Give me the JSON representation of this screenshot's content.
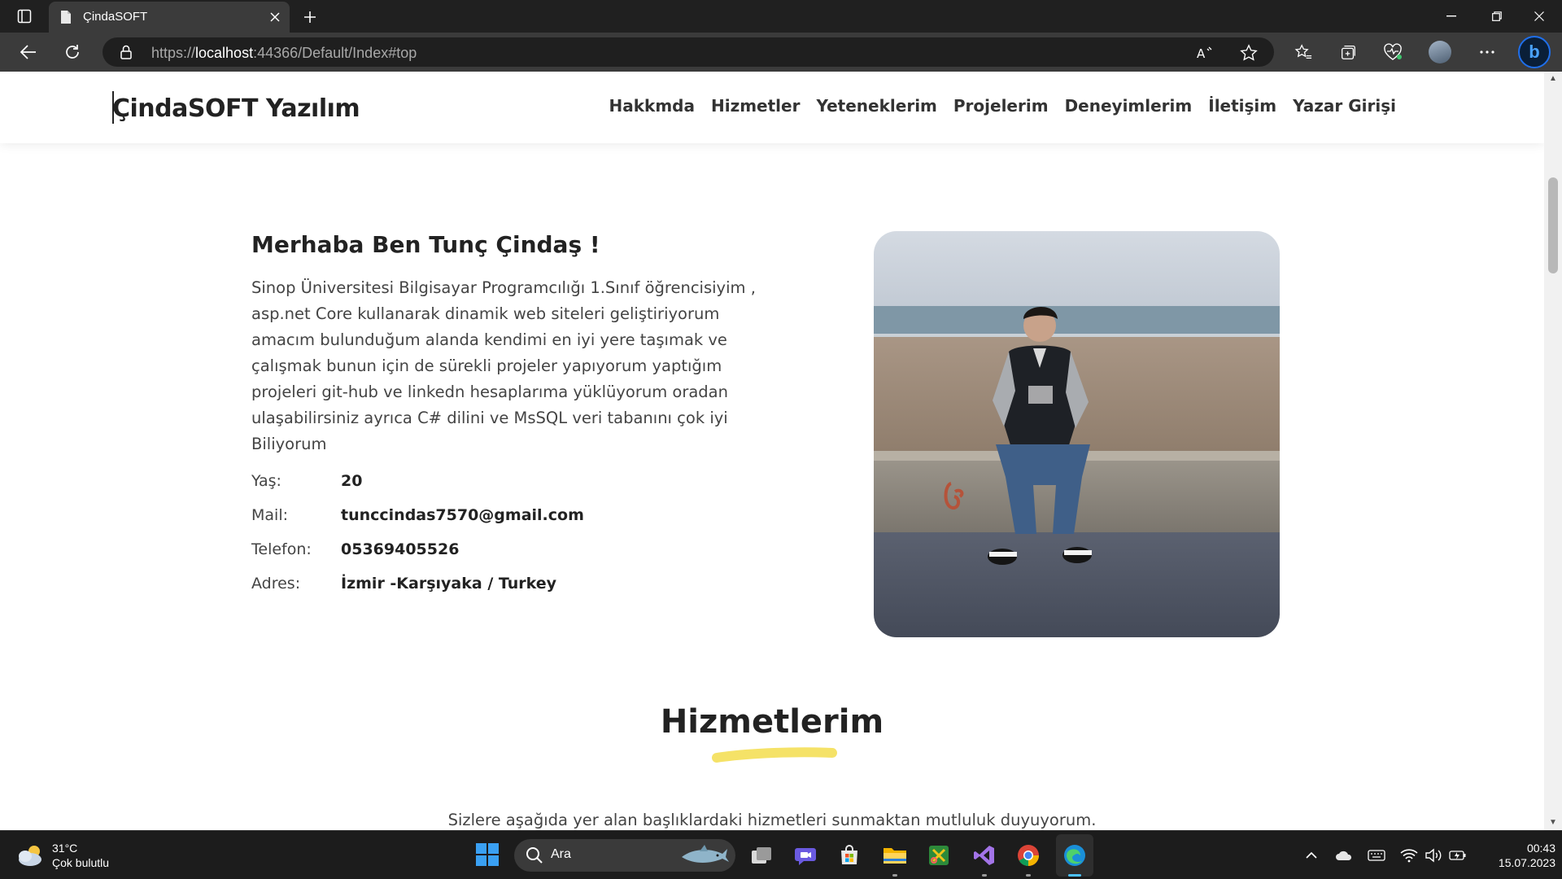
{
  "browser": {
    "tab_title": "ÇindaSOFT",
    "url_prefix": "https://",
    "url_host": "localhost",
    "url_rest": ":44366/Default/Index#top"
  },
  "site": {
    "brand": "ÇindaSOFT Yazılım",
    "nav": [
      "Hakkmda",
      "Hizmetler",
      "Yeteneklerim",
      "Projelerim",
      "Deneyimlerim",
      "İletişim",
      "Yazar Girişi"
    ]
  },
  "about": {
    "title": "Merhaba Ben Tunç Çindaş !",
    "text": "Sinop Üniversitesi Bilgisayar Programcılığı 1.Sınıf öğrencisiyim , asp.net Core kullanarak dinamik web siteleri geliştiriyorum amacım bulunduğum alanda kendimi en iyi yere taşımak ve çalışmak bunun için de sürekli projeler yapıyorum yaptığım projeleri git-hub ve linkedn hesaplarıma yüklüyorum oradan ulaşabilirsiniz ayrıca C# dilini ve MsSQL veri tabanını çok iyi Biliyorum",
    "info": [
      {
        "label": "Yaş:",
        "value": "20"
      },
      {
        "label": "Mail:",
        "value": "tunccindas7570@gmail.com"
      },
      {
        "label": "Telefon:",
        "value": "05369405526"
      },
      {
        "label": "Adres:",
        "value": "İzmir -Karşıyaka / Turkey"
      }
    ]
  },
  "services": {
    "title": "Hizmetlerim",
    "subtitle": "Sizlere aşağıda yer alan başlıklardaki hizmetleri sunmaktan mutluluk duyuyorum.",
    "underline_color": "#f5e267"
  },
  "taskbar": {
    "weather_temp": "31°C",
    "weather_desc": "Çok bulutlu",
    "search_label": "Ara",
    "time": "00:43",
    "date": "15.07.2023",
    "apps": [
      "task-view",
      "teams-chat",
      "microsoft-store",
      "file-explorer",
      "snipping-tool",
      "visual-studio",
      "chrome",
      "edge"
    ]
  },
  "colors": {
    "tabbar": "#202020",
    "toolbar": "#3b3b3b",
    "text_dark": "#222222",
    "text_body": "#444444",
    "accent_yellow": "#f5e267"
  }
}
